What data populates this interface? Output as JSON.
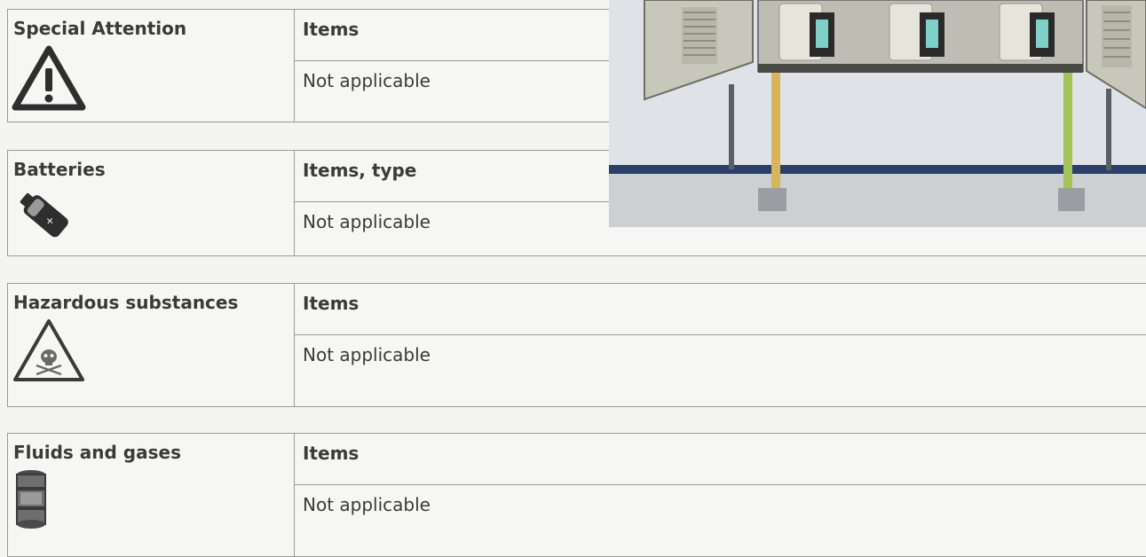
{
  "sections": [
    {
      "label": "Special Attention",
      "header": "Items",
      "value": "Not applicable",
      "icon": "warning-triangle-icon"
    },
    {
      "label": "Batteries",
      "header": "Items, type",
      "value": "Not applicable",
      "icon": "battery-icon"
    },
    {
      "label": "Hazardous substances",
      "header": "Items",
      "value": "Not applicable",
      "icon": "skull-crossbones-hazard-icon"
    },
    {
      "label": "Fluids and gases",
      "header": "Items",
      "value": "Not applicable",
      "icon": "barrel-icon"
    }
  ],
  "colors": {
    "page_background": "#f4f4f2",
    "border": "#9a9a9a",
    "text": "#3a3a3a"
  }
}
